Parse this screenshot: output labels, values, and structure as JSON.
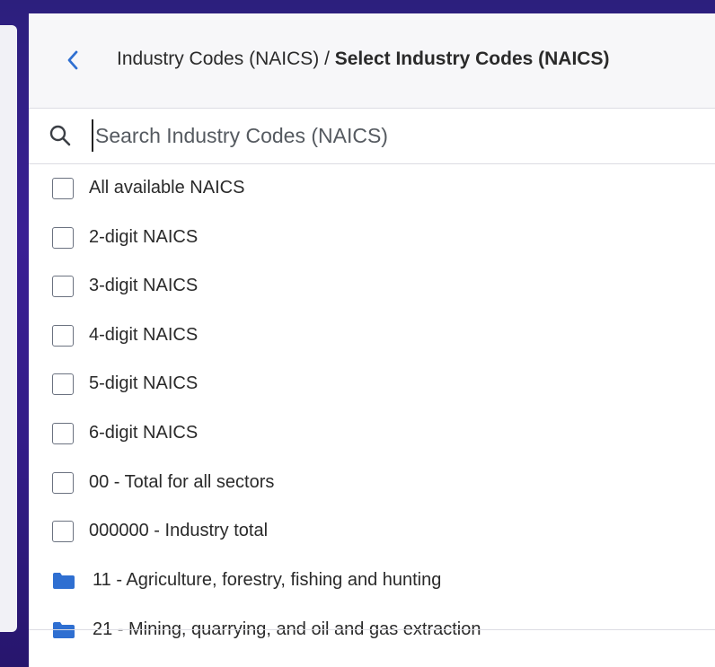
{
  "header": {
    "back_icon": "chevron-left-icon",
    "breadcrumb_parent": "Industry Codes (NAICS) / ",
    "breadcrumb_current": "Select Industry Codes (NAICS)"
  },
  "search": {
    "icon": "search-icon",
    "placeholder": "Search Industry Codes (NAICS)",
    "value": ""
  },
  "checkbox_items": [
    {
      "label": "All available NAICS",
      "checked": false
    },
    {
      "label": "2-digit NAICS",
      "checked": false
    },
    {
      "label": "3-digit NAICS",
      "checked": false
    },
    {
      "label": "4-digit NAICS",
      "checked": false
    },
    {
      "label": "5-digit NAICS",
      "checked": false
    },
    {
      "label": "6-digit NAICS",
      "checked": false
    },
    {
      "label": "00 - Total for all sectors",
      "checked": false
    },
    {
      "label": "000000 - Industry total",
      "checked": false
    }
  ],
  "folder_items": [
    {
      "label": "11 - Agriculture, forestry, fishing and hunting",
      "icon": "folder-icon"
    },
    {
      "label": "21 - Mining, quarrying, and oil and gas extraction",
      "icon": "folder-icon"
    }
  ],
  "colors": {
    "accent": "#2f6fd1",
    "folder": "#2f6fd1",
    "background_gradient": "#3a1f94"
  }
}
